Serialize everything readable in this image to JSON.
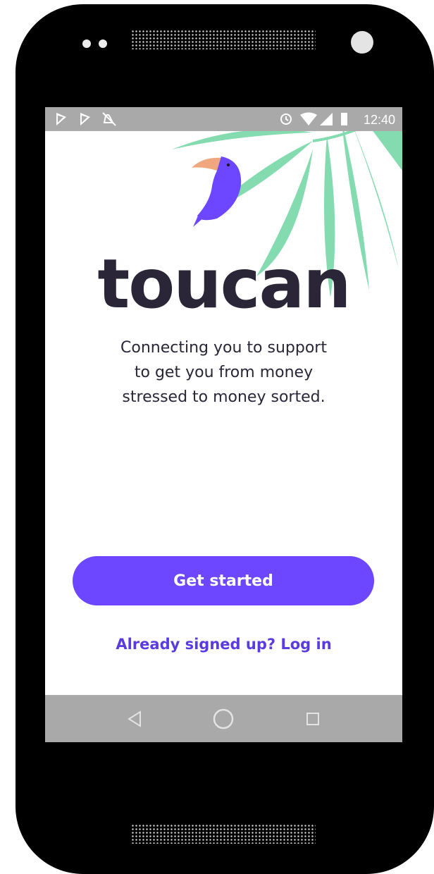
{
  "status_bar": {
    "time": "12:40",
    "left_icons": [
      "notification-icon",
      "notification-icon",
      "sync-off-icon"
    ],
    "right_icons": [
      "alarm-icon",
      "wifi-icon",
      "signal-icon",
      "battery-icon"
    ]
  },
  "app": {
    "logo_text": "toucan",
    "tagline_lines": [
      "Connecting you to support",
      "to get you from money",
      "stressed to money sorted."
    ],
    "primary_button": "Get started",
    "secondary_link": "Already signed up? Log in"
  },
  "nav_bar": {
    "buttons": [
      "back-icon",
      "home-icon",
      "recents-icon"
    ]
  },
  "colors": {
    "accent": "#6c47ff",
    "link": "#5a3be0",
    "text": "#2a2637",
    "leaf": "#84dbb0",
    "beak": "#f0a77e"
  }
}
